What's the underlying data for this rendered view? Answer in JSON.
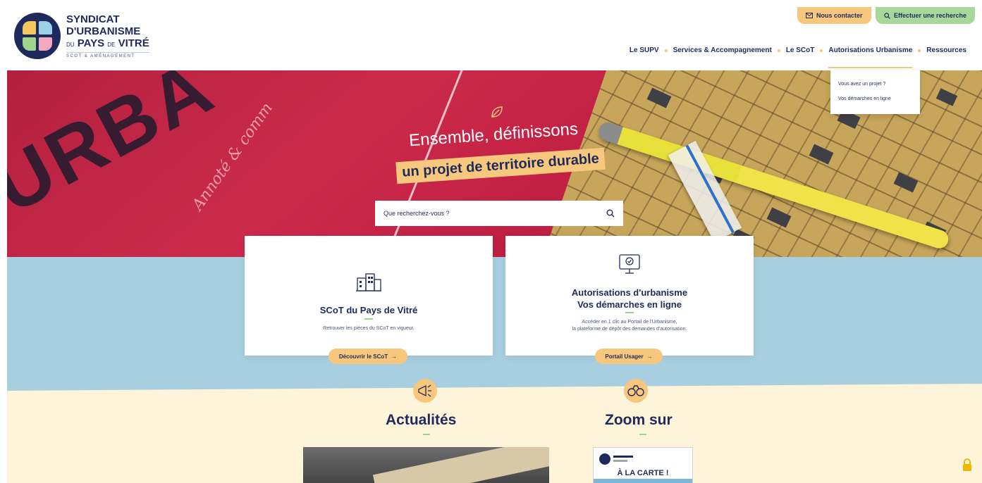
{
  "brand": {
    "line1": "SYNDICAT",
    "line2": "D'URBANISME",
    "line3_prefix": "DU",
    "line3_main": "PAYS",
    "line3_de": "DE",
    "line3_end": "VITRÉ",
    "tagline": "SCOT & AMÉNAGEMENT",
    "colors": {
      "navy": "#1f2a5c",
      "yellow": "#f6c95f",
      "blue": "#9bd0e6",
      "green": "#9fd58a",
      "pink": "#f3a7c0"
    }
  },
  "top_buttons": {
    "contact": "Nous contacter",
    "search": "Effectuer une recherche"
  },
  "nav": {
    "items": [
      "Le SUPV",
      "Services & Accompagnement",
      "Le SCoT",
      "Autorisations Urbanisme",
      "Ressources"
    ],
    "active_index": 3
  },
  "dropdown": {
    "items": [
      "Vous avez un projet ?",
      "Vos démarches en ligne"
    ]
  },
  "hero": {
    "title_line1": "Ensemble, définissons",
    "title_line2": "un projet de territoire durable",
    "background_text": "URBA",
    "background_small": "Annoté & comm",
    "search_placeholder": "Que recherchez-vous ?"
  },
  "cards": [
    {
      "title": "SCoT du Pays de Vitré",
      "description": "Retrouver les pièces du SCoT en vigueur.",
      "button": "Découvrir le SCoT"
    },
    {
      "title_line1": "Autorisations d'urbanisme",
      "title_line2": "Vos démarches en ligne",
      "description_line1": "Accéder en 1 clic au Portail de l'Urbanisme,",
      "description_line2": "la plateforme de dépôt des demandes d'autorisation.",
      "button": "Portail Usager"
    }
  ],
  "sections": {
    "news_title": "Actualités",
    "zoom_title": "Zoom sur",
    "zoom_card_title": "À LA CARTE !"
  },
  "colors": {
    "accent_yellow": "#f6c77c",
    "accent_green": "#a7d89a",
    "band_blue": "#a7cfe0",
    "band_cream": "#fdf4d9",
    "hero_red": "#c11f42"
  }
}
